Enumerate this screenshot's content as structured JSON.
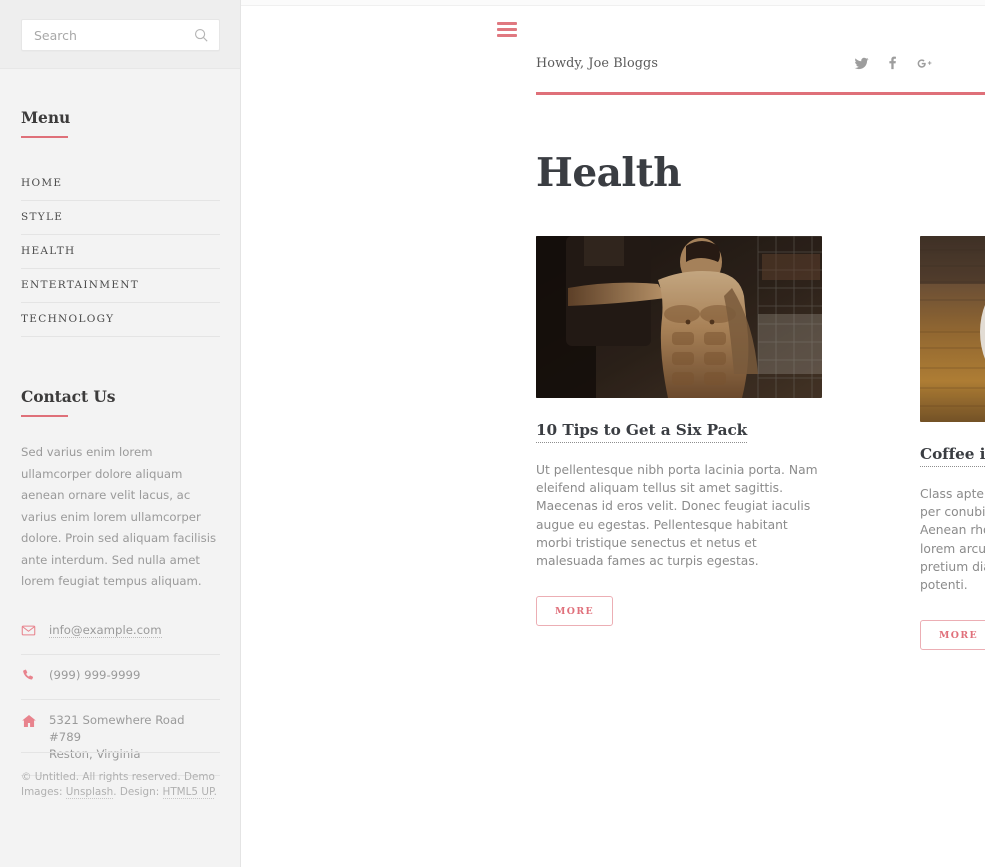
{
  "sidebar": {
    "search": {
      "placeholder": "Search",
      "value": "",
      "icon": "search-icon"
    },
    "menu": {
      "heading": "Menu",
      "items": [
        {
          "label": "HOME"
        },
        {
          "label": "STYLE"
        },
        {
          "label": "HEALTH"
        },
        {
          "label": "ENTERTAINMENT"
        },
        {
          "label": "TECHNOLOGY"
        }
      ]
    },
    "contact": {
      "heading": "Contact Us",
      "body": "Sed varius enim lorem ullamcorper dolore aliquam aenean ornare velit lacus, ac varius enim lorem ullamcorper dolore. Proin sed aliquam facilisis ante interdum. Sed nulla amet lorem feugiat tempus aliquam.",
      "items": [
        {
          "icon": "envelope-icon",
          "text": "info@example.com",
          "link": true
        },
        {
          "icon": "phone-icon",
          "text": "(999) 999-9999",
          "link": false
        },
        {
          "icon": "home-icon",
          "text": "5321 Somewhere Road #789\nReston, Virginia",
          "link": false
        }
      ]
    },
    "copyright": {
      "prefix": "© Untitled. All rights reserved. Demo Images: ",
      "link1": "Unsplash",
      "middle": ". Design: ",
      "link2": "HTML5 UP",
      "suffix": "."
    }
  },
  "header": {
    "menu_toggle": "hamburger-icon",
    "greeting": "Howdy, Joe Bloggs",
    "socials": [
      {
        "name": "twitter-icon",
        "label": "Twitter"
      },
      {
        "name": "facebook-icon",
        "label": "Facebook"
      },
      {
        "name": "googleplus-icon",
        "label": "Google+"
      }
    ]
  },
  "main": {
    "title": "Health",
    "posts": [
      {
        "image_alt": "Muscular man in a gym",
        "title": "10 Tips to Get a Six Pack",
        "body": "Ut pellentesque nibh porta lacinia porta. Nam eleifend aliquam tellus sit amet sagittis. Maecenas id eros velit. Donec feugiat iaculis augue eu egestas. Pellentesque habitant morbi tristique senectus et netus et malesuada fames ac turpis egestas.",
        "more_label": "More"
      },
      {
        "image_alt": "Cup of latte with leaf art on a wooden table",
        "title": "Coffee is Good for Your Health",
        "body": "Class aptent taciti sociosqu ad litora torquent per conubia nostra, per inceptos himenaeos. Aenean rhoncus, nulla ut mattis tempor, lorem arcu malesuada purus, sit amet pretium diam ligula at ante. Suspendisse potenti.",
        "more_label": "More"
      }
    ]
  },
  "colors": {
    "accent": "#df7079",
    "accent_light": "#e8838d",
    "heading": "#3a3d42",
    "body_text": "#8b8b8b",
    "sidebar_bg": "#f3f3f3",
    "rule": "#e4e4e4"
  }
}
